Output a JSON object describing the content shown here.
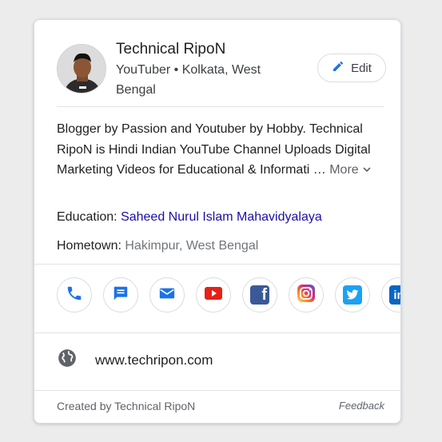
{
  "profile": {
    "name": "Technical RipoN",
    "subtitle": "YouTuber • Kolkata, West Bengal",
    "edit_label": "Edit"
  },
  "description": {
    "text": "Blogger by Passion and Youtuber by Hobby. Technical RipoN is Hindi Indian YouTube Channel Uploads Digital Marketing Videos for Educational & Informati …",
    "more_label": "More"
  },
  "education": {
    "label": "Education:",
    "value": "Saheed Nurul Islam Mahavidyalaya"
  },
  "hometown": {
    "label": "Hometown:",
    "value": "Hakimpur, West Bengal"
  },
  "social_icons": [
    "phone-icon",
    "message-icon",
    "mail-icon",
    "youtube-icon",
    "facebook-icon",
    "instagram-icon",
    "twitter-icon",
    "linkedin-icon"
  ],
  "website": {
    "url": "www.techripon.com"
  },
  "footer": {
    "created_by": "Created by Technical RipoN",
    "feedback": "Feedback"
  },
  "colors": {
    "phone": "#1a73e8",
    "message": "#1a73e8",
    "mail": "#1a73e8",
    "youtube": "#e62117",
    "facebook": "#3b5998",
    "twitter": "#1da1f2",
    "linkedin": "#0a66c2",
    "link": "#1a0dab"
  }
}
